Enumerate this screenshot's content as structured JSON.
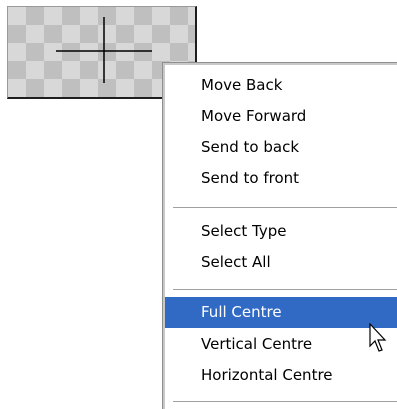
{
  "context_menu": {
    "groups": [
      [
        "Move Back",
        "Move Forward",
        "Send to back",
        "Send to front"
      ],
      [
        "Select Type",
        "Select All"
      ],
      [
        "Full Centre",
        "Vertical Centre",
        "Horizontal Centre"
      ]
    ],
    "highlighted_item": "Full Centre"
  },
  "colors": {
    "highlight_bg": "#316ac5",
    "highlight_text": "#ffffff",
    "menu_text": "#000000",
    "checker_light": "#d8d8d8",
    "checker_dark": "#bfbfbf"
  },
  "icons": {
    "canvas_crosshair": "crosshair-icon",
    "pointer": "mouse-pointer-icon"
  }
}
